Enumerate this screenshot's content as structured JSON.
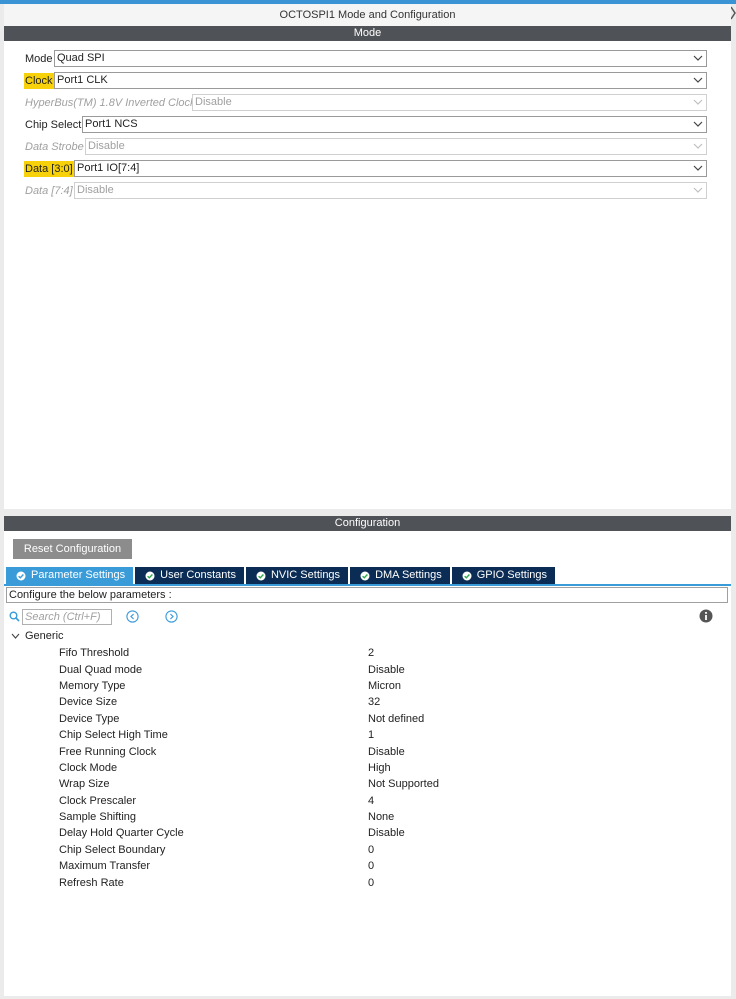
{
  "window": {
    "title": "OCTOSPI1 Mode and Configuration"
  },
  "mode": {
    "header": "Mode",
    "rows": [
      {
        "label": "Mode",
        "value": "Quad SPI",
        "highlight": false,
        "disabled": false
      },
      {
        "label": "Clock",
        "value": "Port1 CLK",
        "highlight": true,
        "disabled": false
      },
      {
        "label": "HyperBus(TM) 1.8V Inverted Clock",
        "value": "Disable",
        "highlight": false,
        "disabled": true
      },
      {
        "label": "Chip Select",
        "value": "Port1 NCS",
        "highlight": false,
        "disabled": false
      },
      {
        "label": "Data Strobe",
        "value": "Disable",
        "highlight": false,
        "disabled": true
      },
      {
        "label": "Data [3:0]",
        "value": "Port1 IO[7:4]",
        "highlight": true,
        "disabled": false
      },
      {
        "label": "Data [7:4]",
        "value": "Disable",
        "highlight": false,
        "disabled": true
      }
    ]
  },
  "configuration": {
    "header": "Configuration",
    "reset_button": "Reset Configuration",
    "tabs": [
      {
        "label": "Parameter Settings",
        "active": true
      },
      {
        "label": "User Constants",
        "active": false
      },
      {
        "label": "NVIC Settings",
        "active": false
      },
      {
        "label": "DMA Settings",
        "active": false
      },
      {
        "label": "GPIO Settings",
        "active": false
      }
    ],
    "configure_text": "Configure the below parameters :",
    "search_placeholder": "Search (Ctrl+F)",
    "group": "Generic",
    "params": [
      {
        "name": "Fifo Threshold",
        "value": "2"
      },
      {
        "name": "Dual Quad mode",
        "value": "Disable"
      },
      {
        "name": "Memory Type",
        "value": "Micron"
      },
      {
        "name": "Device Size",
        "value": "32"
      },
      {
        "name": "Device Type",
        "value": "Not defined"
      },
      {
        "name": "Chip Select High Time",
        "value": "1"
      },
      {
        "name": "Free Running Clock",
        "value": "Disable"
      },
      {
        "name": "Clock Mode",
        "value": "High"
      },
      {
        "name": "Wrap Size",
        "value": "Not Supported"
      },
      {
        "name": "Clock Prescaler",
        "value": "4"
      },
      {
        "name": "Sample Shifting",
        "value": "None"
      },
      {
        "name": "Delay Hold Quarter Cycle",
        "value": "Disable"
      },
      {
        "name": "Chip Select Boundary",
        "value": "0"
      },
      {
        "name": "Maximum Transfer",
        "value": "0"
      },
      {
        "name": "Refresh Rate",
        "value": "0"
      }
    ]
  },
  "colors": {
    "accent": "#3a9bd9",
    "tab_dark": "#0b2d55",
    "header_bar": "#4f5256",
    "highlight": "#f7d10a"
  },
  "icons": {
    "tab_check": "check-circle-icon",
    "search": "search-icon",
    "prev": "chevron-left-circle-icon",
    "next": "chevron-right-circle-icon",
    "info": "info-icon",
    "tree_expand": "chevron-down-icon",
    "select_arrow": "chevron-down-icon"
  }
}
